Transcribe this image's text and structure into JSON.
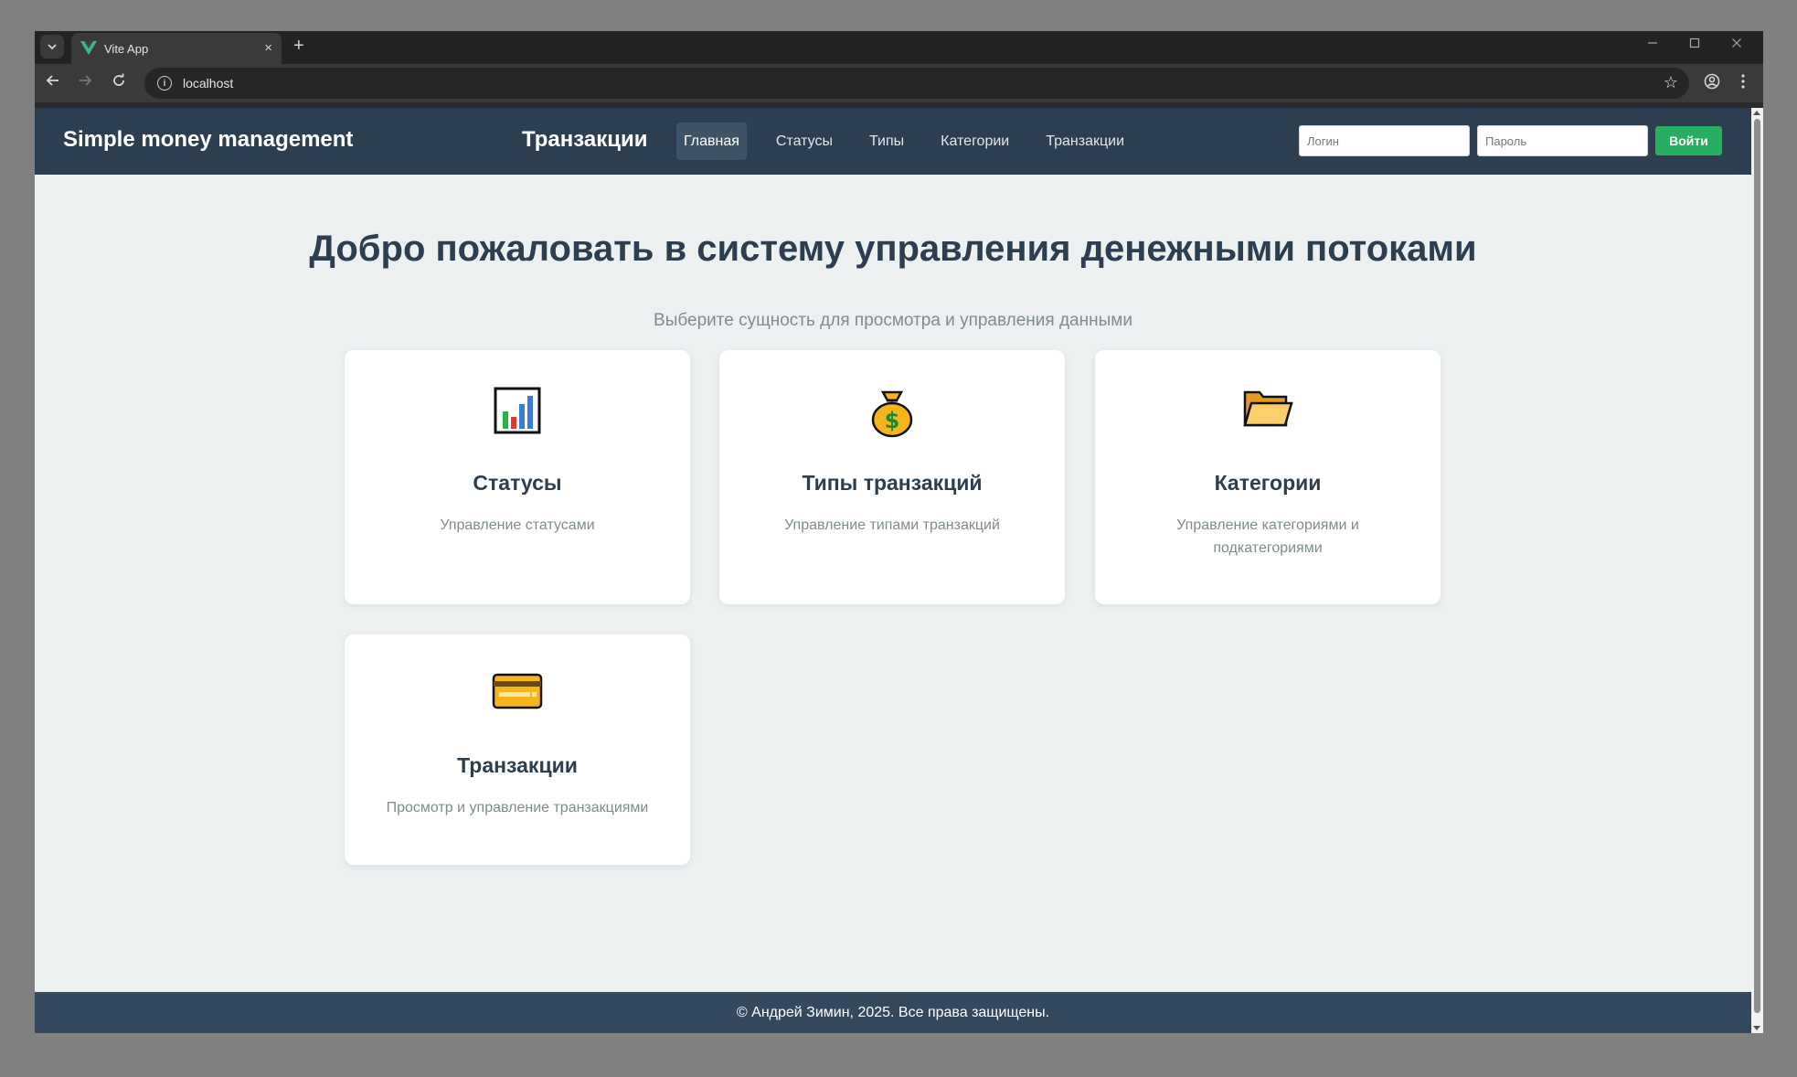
{
  "browser": {
    "tab_title": "Vite App",
    "tab_close": "×",
    "new_tab": "+",
    "url": "localhost"
  },
  "app": {
    "brand": "Simple money management",
    "page_title": "Транзакции",
    "nav": [
      "Главная",
      "Статусы",
      "Типы",
      "Категории",
      "Транзакции"
    ],
    "active_nav": "Главная",
    "login": {
      "login_placeholder": "Логин",
      "password_placeholder": "Пароль",
      "submit_label": "Войти"
    }
  },
  "main": {
    "title": "Добро пожаловать в систему управления денежными потоками",
    "subtitle": "Выберите сущность для просмотра и управления данными",
    "cards": [
      {
        "icon": "bar-chart-icon",
        "title": "Статусы",
        "description": "Управление статусами"
      },
      {
        "icon": "money-bag-icon",
        "title": "Типы транзакций",
        "description": "Управление типами транзакций"
      },
      {
        "icon": "folder-icon",
        "title": "Категории",
        "description": "Управление категориями и подкатегориями"
      },
      {
        "icon": "credit-card-icon",
        "title": "Транзакции",
        "description": "Просмотр и управление транзакциями"
      }
    ]
  },
  "footer": {
    "text": "© Андрей Зимин, 2025. Все права защищены."
  },
  "colors": {
    "header_bg": "#2c3e50",
    "page_bg": "#ecf0f1",
    "accent_green": "#27ae60",
    "footer_bg": "#34495e"
  }
}
